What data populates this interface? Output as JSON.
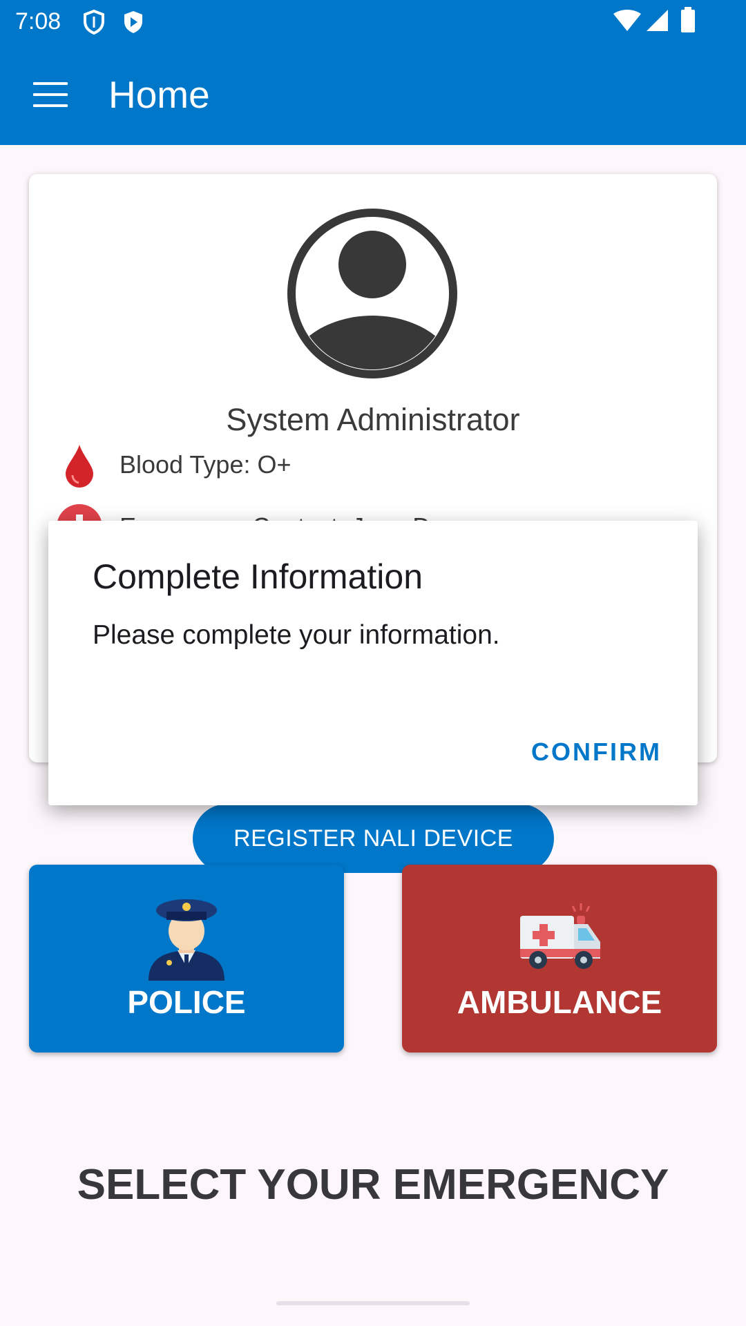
{
  "status_bar": {
    "time": "7:08",
    "icons": [
      "shield-outline-icon",
      "shield-play-icon",
      "wifi-icon",
      "cell-signal-icon",
      "battery-icon"
    ]
  },
  "app_bar": {
    "title": "Home",
    "menu_icon": "hamburger-menu-icon",
    "color": "#0177c9"
  },
  "profile": {
    "name": "System Administrator",
    "blood_type": "Blood Type: O+",
    "emergency_contact_partial": "Emergency Contact: Juan D"
  },
  "dialog": {
    "title": "Complete Information",
    "message": "Please complete your information.",
    "confirm_label": "CONFIRM"
  },
  "register_button": "REGISTER NALI DEVICE",
  "emergency": {
    "police_label": "POLICE",
    "police_color": "#0177c9",
    "ambulance_label": "AMBULANCE",
    "ambulance_color": "#b23632",
    "prompt": "SELECT YOUR EMERGENCY"
  }
}
